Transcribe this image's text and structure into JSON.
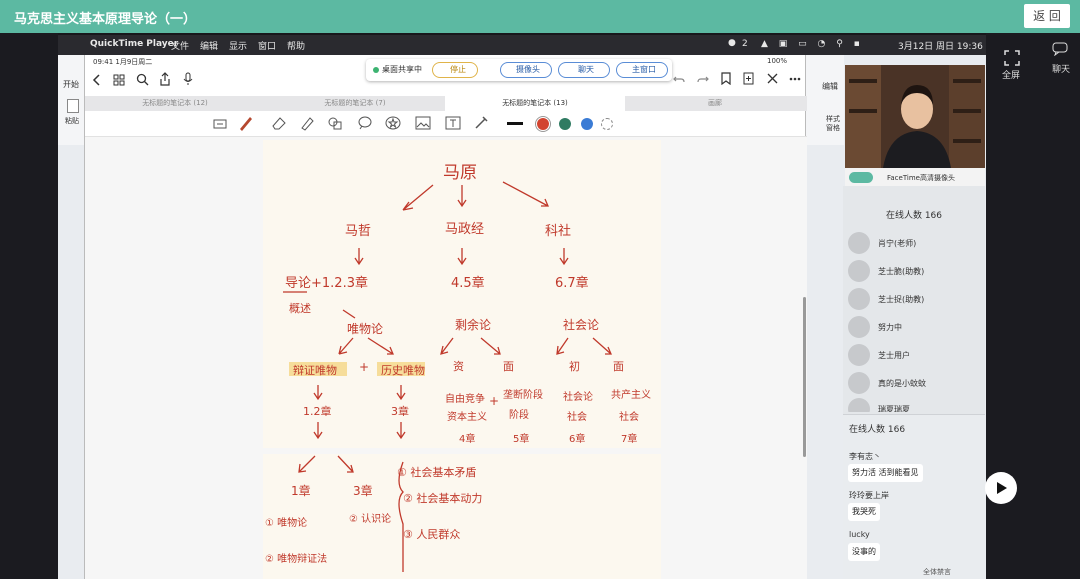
{
  "app": {
    "title": "马克思主义基本原理导论（一）",
    "back_label": "返 回"
  },
  "macbar": {
    "app_name": "QuickTime Player",
    "menu": [
      "文件",
      "编辑",
      "显示",
      "窗口",
      "帮助"
    ],
    "wechat_count": "2",
    "clock": "3月12日 周日  19:36"
  },
  "word": {
    "tab": "开始",
    "paste": "粘贴"
  },
  "right_word": {
    "edit": "编辑",
    "style": "样式\n窗格"
  },
  "ipad": {
    "time": "09:41  1月9日周二",
    "battery": "100%",
    "tabs": [
      "无标题的笔记本 (12)",
      "无标题的笔记本 (7)",
      "无标题的笔记本 (13)",
      "画廊"
    ],
    "active_tab_index": 2,
    "doc_title": "无标题的笔记本 (13)"
  },
  "share": {
    "status": "桌面共享中",
    "stop": "停止",
    "camera": "摄像头",
    "chat": "聊天",
    "main_window": "主窗口"
  },
  "notes": {
    "root": "马原",
    "branches": [
      "马哲",
      "马政经",
      "科社"
    ],
    "ch_phil": "导论+1.2.3章",
    "ch_phil_under": "概述",
    "ch_econ": "4.5章",
    "ch_soc": "6.7章",
    "phil_sub": "唯物论",
    "econ_sub": "剩余论",
    "soc_sub": "社会论",
    "phil_leaf1": "辩证唯物",
    "phil_plus": "+",
    "phil_leaf2": "历史唯物",
    "phil_ch1": "1.2章",
    "phil_ch2": "3章",
    "econ_leaf1": "资",
    "econ_leaf2": "面",
    "econ_d1": "自由竞争",
    "econ_d1b": "资本主义",
    "econ_plus": "+",
    "econ_d2": "垄断阶段",
    "econ_d2b": "阶段",
    "econ_ch1": "4章",
    "econ_ch2": "5章",
    "soc_leaf1": "初",
    "soc_leaf2": "面",
    "soc_d1": "社会论",
    "soc_d1b": "社会",
    "soc_d2": "共产主义",
    "soc_d2b": "社会",
    "soc_ch1": "6章",
    "soc_ch2": "7章",
    "p2_left1": "1章",
    "p2_left2": "3章",
    "p2_n1": "① 唯物论",
    "p2_n2": "② 认识论",
    "p2_n3": "② 唯物辩证法",
    "p2_list1": "① 社会基本矛盾",
    "p2_list2": "② 社会基本动力",
    "p2_list3": "③ 人民群众"
  },
  "camera": {
    "device": "FaceTime高清摄像头"
  },
  "sidebar_labels": {
    "fullscreen": "全屏",
    "chat": "聊天"
  },
  "panel": {
    "online_top": "在线人数 166",
    "users": [
      "肖宁(老师)",
      "芝士脆(助教)",
      "芝士捉(助教)",
      "努力中",
      "芝士用户",
      "真的是小蚊蚊",
      "瑞夏瑞夏"
    ],
    "online_chat": "在线人数 166",
    "messages": [
      {
        "nick": "李有志丶",
        "text": "努力活  活到能看见"
      },
      {
        "nick": "玲玲要上岸",
        "text": "我哭死"
      },
      {
        "nick": "lucky",
        "text": "没事的"
      }
    ],
    "footer": "全体禁言"
  },
  "colors": {
    "topbar": "#5cb9a2",
    "ink": "#c0392b",
    "highlight": "#f6d98c",
    "pen_red": "#d2432f",
    "pen_green": "#2f7b62",
    "pen_blue": "#3a7bd5"
  },
  "icons": [
    "apple-icon",
    "back-arrow-icon",
    "grid-icon",
    "search-icon",
    "share-icon",
    "mic-icon",
    "undo-icon",
    "redo-icon",
    "bookmark-icon",
    "add-page-icon",
    "close-icon",
    "more-icon",
    "lasso-icon",
    "pen-icon",
    "eraser-icon",
    "highlighter-icon",
    "shapes-icon",
    "bubble-icon",
    "star-icon",
    "image-icon",
    "text-icon",
    "laser-icon",
    "fullscreen-icon",
    "chat-bubble-icon",
    "play-icon"
  ]
}
